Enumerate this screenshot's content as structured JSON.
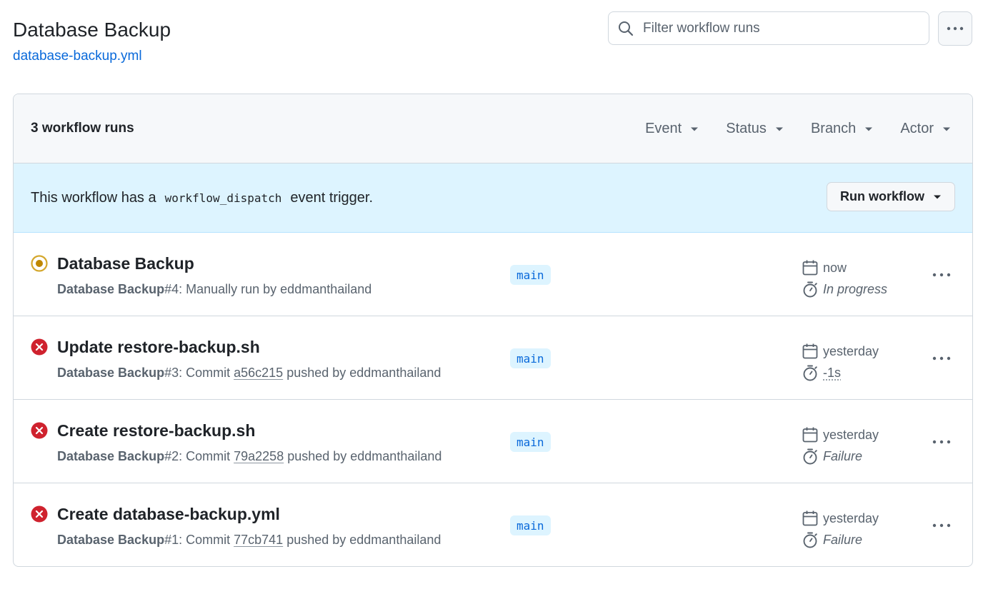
{
  "header": {
    "title": "Database Backup",
    "file_link": "database-backup.yml",
    "search_placeholder": "Filter workflow runs"
  },
  "list": {
    "count_label": "3 workflow runs",
    "filters": [
      "Event",
      "Status",
      "Branch",
      "Actor"
    ]
  },
  "banner": {
    "text_before": "This workflow has a",
    "code": "workflow_dispatch",
    "text_after": "event trigger.",
    "button_label": "Run workflow"
  },
  "runs": [
    {
      "status": "in-progress",
      "title": "Database Backup",
      "workflow": "Database Backup",
      "number": "#4",
      "sub_prefix": ": Manually run by eddmanthailand",
      "sha": "",
      "sub_suffix": "",
      "branch": "main",
      "when": "now",
      "duration": "In progress"
    },
    {
      "status": "failure",
      "title": "Update restore-backup.sh",
      "workflow": "Database Backup",
      "number": "#3",
      "sub_prefix": ": Commit ",
      "sha": "a56c215",
      "sub_suffix": " pushed by eddmanthailand",
      "branch": "main",
      "when": "yesterday",
      "duration": "-1s"
    },
    {
      "status": "failure",
      "title": "Create restore-backup.sh",
      "workflow": "Database Backup",
      "number": "#2",
      "sub_prefix": ": Commit ",
      "sha": "79a2258",
      "sub_suffix": " pushed by eddmanthailand",
      "branch": "main",
      "when": "yesterday",
      "duration": "Failure"
    },
    {
      "status": "failure",
      "title": "Create database-backup.yml",
      "workflow": "Database Backup",
      "number": "#1",
      "sub_prefix": ": Commit ",
      "sha": "77cb741",
      "sub_suffix": " pushed by eddmanthailand",
      "branch": "main",
      "when": "yesterday",
      "duration": "Failure"
    }
  ],
  "colors": {
    "link": "#0969da",
    "failure": "#cf222e",
    "in_progress": "#d4a72c",
    "banner_bg": "#ddf4ff"
  }
}
